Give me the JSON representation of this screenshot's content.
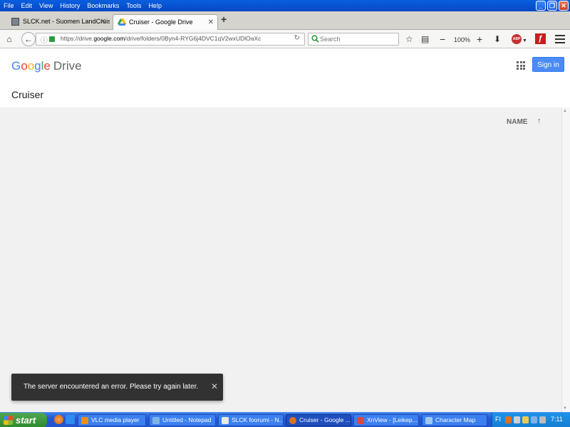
{
  "menu": [
    "File",
    "Edit",
    "View",
    "History",
    "Bookmarks",
    "Tools",
    "Help"
  ],
  "window_controls": {
    "minimize": "_",
    "maximize": "❐",
    "close": "✕"
  },
  "tabs": [
    {
      "title": "SLCK.net - Suomen LandCruis...",
      "icon": "site-favicon"
    },
    {
      "title": "Cruiser - Google Drive",
      "icon": "google-drive-icon"
    }
  ],
  "new_tab_label": "+",
  "url": {
    "prefix": "https://drive.",
    "domain": "google.com",
    "rest": "/drive/folders/0Byn4-RYG6j4DVC1qV2wxUDlOaXc"
  },
  "search_placeholder": "Search",
  "zoom": "100%",
  "drive": {
    "logo_letters": [
      "G",
      "o",
      "o",
      "g",
      "l",
      "e"
    ],
    "logo_product": "Drive",
    "signin_label": "Sign in",
    "folder_title": "Cruiser",
    "sort_label": "NAME",
    "sort_arrow": "↑"
  },
  "toast": {
    "message": "The server encountered an error. Please try again later.",
    "close": "✕"
  },
  "taskbar": {
    "start_label": "start",
    "tasks": [
      {
        "label": "VLC media player",
        "color": "#f08c1a"
      },
      {
        "label": "Untitled - Notepad",
        "color": "#7fb3e8"
      },
      {
        "label": "SLCK foorumi - N...",
        "color": "#e8e8e8"
      },
      {
        "label": "Cruiser - Google ...",
        "color": "#e0701a"
      },
      {
        "label": "XnView - [Leikep...",
        "color": "#d94a3a"
      },
      {
        "label": "Character Map",
        "color": "#9fc9f0"
      }
    ],
    "language": "FI",
    "clock": "7:11"
  }
}
